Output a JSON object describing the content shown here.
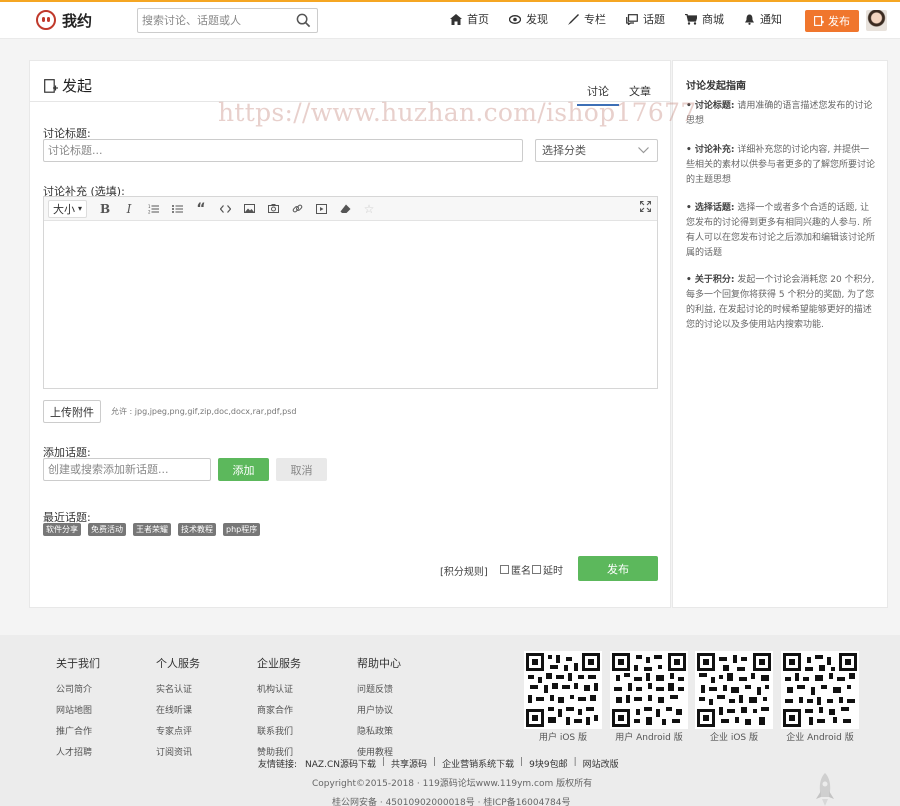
{
  "header": {
    "logo_text": "我约",
    "search_placeholder": "搜索讨论、话题或人",
    "nav": [
      {
        "label": "首页",
        "icon": "home-icon"
      },
      {
        "label": "发现",
        "icon": "eye-icon"
      },
      {
        "label": "专栏",
        "icon": "pen-icon"
      },
      {
        "label": "话题",
        "icon": "chat-icon"
      },
      {
        "label": "商城",
        "icon": "cart-icon"
      },
      {
        "label": "通知",
        "icon": "bell-icon"
      }
    ],
    "publish_label": "发布"
  },
  "main": {
    "title": "发起",
    "tabs": [
      {
        "label": "讨论",
        "active": true
      },
      {
        "label": "文章",
        "active": false
      }
    ],
    "topic_title_label": "讨论标题:",
    "topic_title_placeholder": "讨论标题...",
    "category_select": "选择分类",
    "supplement_label": "讨论补充 (选填):",
    "editor": {
      "size_label": "大小",
      "toolbar_icons": [
        "bold-icon",
        "italic-icon",
        "ordered-list-icon",
        "unordered-list-icon",
        "quote-icon",
        "code-icon",
        "image-icon",
        "camera-icon",
        "link-icon",
        "video-icon",
        "eraser-icon",
        "star-icon",
        "fullscreen-icon"
      ],
      "content": ""
    },
    "upload_label": "上传附件",
    "allowed_types": "允许 : jpg,jpeg,png,gif,zip,doc,docx,rar,pdf,psd",
    "add_topic_label": "添加话题:",
    "add_topic_placeholder": "创建或搜索添加新话题...",
    "add_button": "添加",
    "cancel_button": "取消",
    "recent_topics_label": "最近话题:",
    "recent_topics": [
      "软件分享",
      "免费活动",
      "王者荣耀",
      "技术教程",
      "php程序"
    ],
    "rules_link": "[积分规则]",
    "anonymous_label": "匿名",
    "later_label": "延时",
    "submit_button": "发布"
  },
  "sidebar": {
    "title": "讨论发起指南",
    "items": [
      {
        "key": "• 讨论标题:",
        "text": " 请用准确的语言描述您发布的讨论思想"
      },
      {
        "key": "• 讨论补充:",
        "text": " 详细补充您的讨论内容, 并提供一些相关的素材以供参与者更多的了解您所要讨论的主题思想"
      },
      {
        "key": "• 选择话题:",
        "text": " 选择一个或者多个合适的话题, 让您发布的讨论得到更多有相同兴趣的人参与. 所有人可以在您发布讨论之后添加和编辑该讨论所属的话题"
      },
      {
        "key": "• 关于积分:",
        "text": " 发起一个讨论会消耗您 20 个积分, 每多一个回复你将获得 5 个积分的奖励, 为了您的利益, 在发起讨论的时候希望能够更好的描述您的讨论以及多使用站内搜索功能."
      }
    ]
  },
  "watermark": "https://www.huzhan.com/ishop17677",
  "footer": {
    "columns": [
      {
        "title": "关于我们",
        "items": [
          "公司简介",
          "网站地图",
          "推广合作",
          "人才招聘"
        ]
      },
      {
        "title": "个人服务",
        "items": [
          "实名认证",
          "在线听课",
          "专家点评",
          "订阅资讯"
        ]
      },
      {
        "title": "企业服务",
        "items": [
          "机构认证",
          "商家合作",
          "联系我们",
          "赞助我们"
        ]
      },
      {
        "title": "帮助中心",
        "items": [
          "问题反馈",
          "用户协议",
          "隐私政策",
          "使用教程"
        ]
      }
    ],
    "qr_codes": [
      "用户 iOS 版",
      "用户 Android 版",
      "企业 iOS 版",
      "企业 Android 版"
    ],
    "friends_label": "友情链接:",
    "friends": [
      "NAZ.CN源码下载",
      "共享源码",
      "企业营销系统下载",
      "9块9包邮",
      "网站改版"
    ],
    "copyright": "Copyright©2015-2018    · 119源码论坛www.119ym.com 版权所有",
    "icp": "桂公网安备   · 45010902000018号   · 桂ICP备16004784号"
  },
  "colors": {
    "accent": "#f0762d",
    "green": "#5cb85c",
    "tab_active": "#3d6fb6"
  }
}
